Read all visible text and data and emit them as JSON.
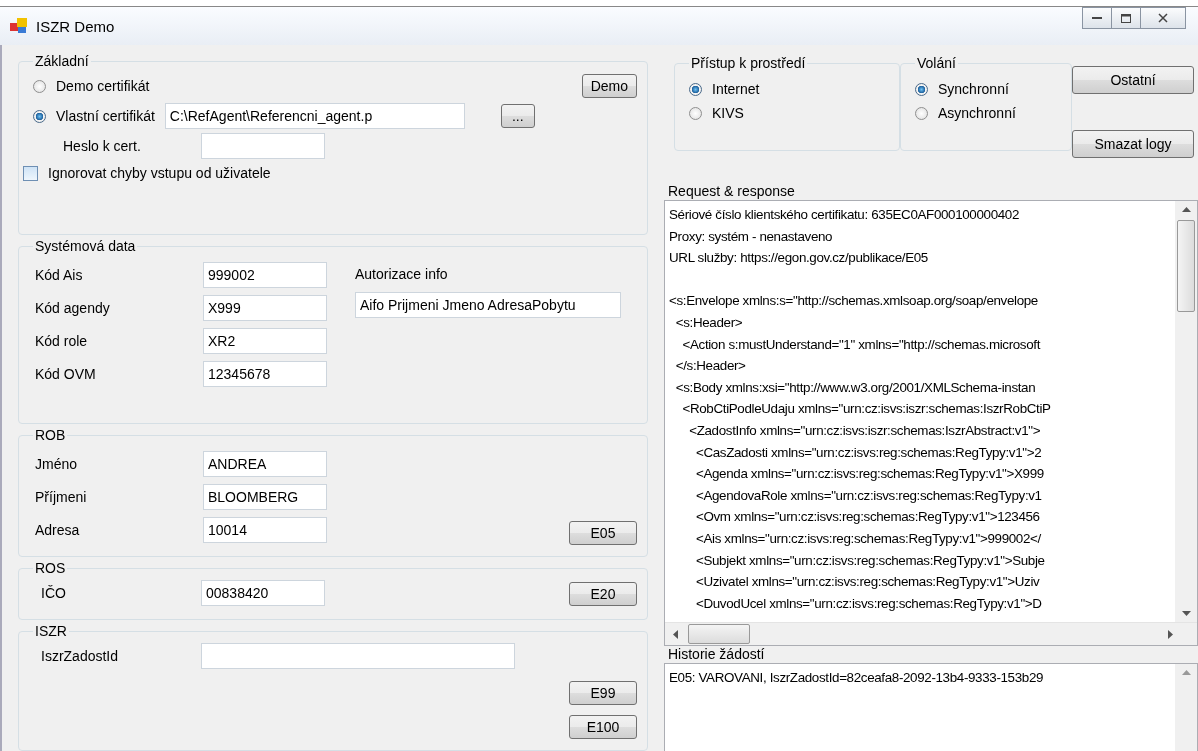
{
  "window": {
    "title": "ISZR Demo"
  },
  "basic": {
    "legend": "Základní",
    "options": [
      {
        "label": "Demo certifikát",
        "selected": false
      },
      {
        "label": "Vlastní certifikát",
        "selected": true
      }
    ],
    "demo_button": "Demo",
    "cert_path": "C:\\RefAgent\\Referencni_agent.p",
    "browse_button": "...",
    "password_label": "Heslo k cert.",
    "ignore_checkbox": {
      "label": "Ignorovat chyby vstupu od uživatele",
      "checked": false
    }
  },
  "system_data": {
    "legend": "Systémová data",
    "fields": [
      {
        "label": "Kód Ais",
        "value": "999002"
      },
      {
        "label": "Kód agendy",
        "value": "X999"
      },
      {
        "label": "Kód role",
        "value": "XR2"
      },
      {
        "label": "Kód OVM",
        "value": "12345678"
      }
    ],
    "authorization": {
      "label": "Autorizace info",
      "value": "Aifo Prijmeni Jmeno AdresaPobytu"
    }
  },
  "rob": {
    "legend": "ROB",
    "fields": [
      {
        "label": "Jméno",
        "value": "ANDREA"
      },
      {
        "label": "Příjmeni",
        "value": "BLOOMBERG"
      },
      {
        "label": "Adresa",
        "value": "10014"
      }
    ],
    "button": "E05"
  },
  "ros": {
    "legend": "ROS",
    "fields": [
      {
        "label": "IČO",
        "value": "00838420"
      }
    ],
    "button": "E20"
  },
  "iszr": {
    "legend": "ISZR",
    "field_label": "IszrZadostId",
    "buttons": [
      "E99",
      "E100"
    ]
  },
  "environment": {
    "legend": "Přístup k prostředí",
    "options": [
      {
        "label": "Internet",
        "selected": true
      },
      {
        "label": "KIVS",
        "selected": false
      }
    ]
  },
  "calls": {
    "legend": "Volání",
    "options": [
      {
        "label": "Synchronní",
        "selected": true
      },
      {
        "label": "Asynchronní",
        "selected": false
      }
    ]
  },
  "side_buttons": [
    "Ostatní",
    "Smazat logy"
  ],
  "request_response": {
    "label": "Request & response",
    "header_lines": [
      "Sériové číslo klientského certifikatu: 635EC0AF000100000402",
      "Proxy: systém - nenastaveno",
      "URL služby: https://egon.gov.cz/publikace/E05"
    ],
    "xml_lines": [
      "<s:Envelope xmlns:s=\"http://schemas.xmlsoap.org/soap/envelope",
      "  <s:Header>",
      "    <Action s:mustUnderstand=\"1\" xmlns=\"http://schemas.microsoft",
      "  </s:Header>",
      "  <s:Body xmlns:xsi=\"http://www.w3.org/2001/XMLSchema-instan",
      "    <RobCtiPodleUdaju xmlns=\"urn:cz:isvs:iszr:schemas:IszrRobCtiP",
      "      <ZadostInfo xmlns=\"urn:cz:isvs:iszr:schemas:IszrAbstract:v1\">",
      "        <CasZadosti xmlns=\"urn:cz:isvs:reg:schemas:RegTypy:v1\">2",
      "        <Agenda xmlns=\"urn:cz:isvs:reg:schemas:RegTypy:v1\">X999",
      "        <AgendovaRole xmlns=\"urn:cz:isvs:reg:schemas:RegTypy:v1",
      "        <Ovm xmlns=\"urn:cz:isvs:reg:schemas:RegTypy:v1\">123456",
      "        <Ais xmlns=\"urn:cz:isvs:reg:schemas:RegTypy:v1\">999002</",
      "        <Subjekt xmlns=\"urn:cz:isvs:reg:schemas:RegTypy:v1\">Subje",
      "        <Uzivatel xmlns=\"urn:cz:isvs:reg:schemas:RegTypy:v1\">Uziv",
      "        <DuvodUcel xmlns=\"urn:cz:isvs:reg:schemas:RegTypy:v1\">D"
    ]
  },
  "history": {
    "label": "Historie žádostí",
    "lines": [
      "E05: VAROVANI, IszrZadostId=82ceafa8-2092-13b4-9333-153b29"
    ]
  }
}
